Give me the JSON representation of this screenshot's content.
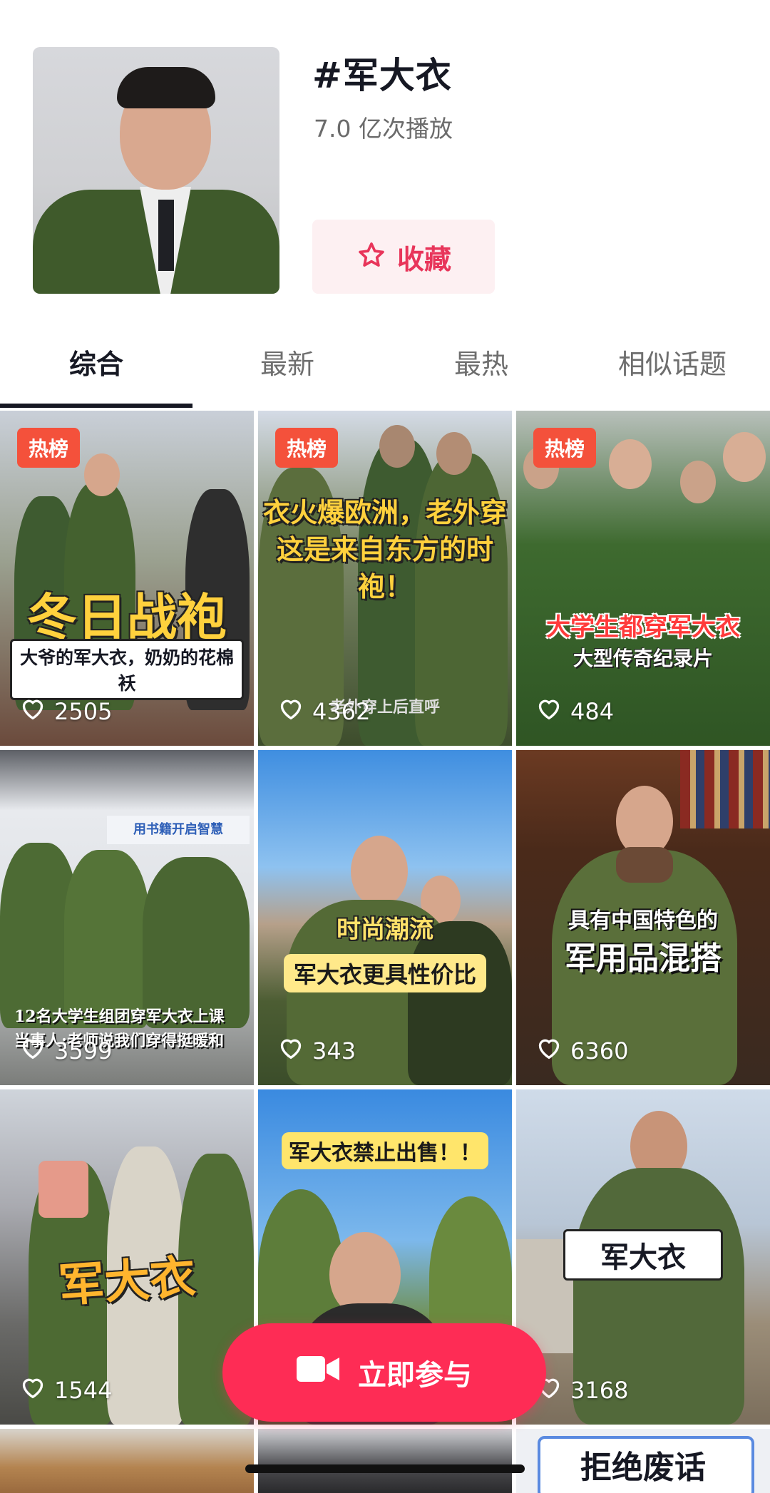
{
  "topic": {
    "title": "#军大衣",
    "play_count": "7.0 亿次播放",
    "favorite_label": "收藏"
  },
  "tabs": [
    "综合",
    "最新",
    "最热",
    "相似话题"
  ],
  "active_tab": 0,
  "colors": {
    "accent": "#fe2c55",
    "badge": "#f4513b",
    "favorite_text": "#e8355a"
  },
  "videos": [
    {
      "badge": "热榜",
      "caption": "冬日战袍",
      "subcaption": "大爷的军大衣，奶奶的花棉袄",
      "likes": "2505"
    },
    {
      "badge": "热榜",
      "caption": "衣火爆欧洲，老外穿",
      "caption2": "这是来自东方的时",
      "caption3": "袍！",
      "subcaption": "老外穿上后直呼",
      "likes": "4362"
    },
    {
      "badge": "热榜",
      "caption": "大学生都穿军大衣",
      "subcaption": "大型传奇纪录片",
      "likes": "484"
    },
    {
      "caption": "12名大学生组团穿军大衣上课",
      "caption2": "当事人:老师说我们穿得挺暖和",
      "banner": "用书籍开启智慧",
      "likes": "3599"
    },
    {
      "caption": "时尚潮流",
      "subcaption": "军大衣更具性价比",
      "likes": "343"
    },
    {
      "caption": "具有中国特色的",
      "caption2": "军用品混搭",
      "likes": "6360"
    },
    {
      "caption": "军大衣",
      "likes": "1544"
    },
    {
      "caption": "军大衣禁止出售！！",
      "likes": ""
    },
    {
      "caption": "军大衣",
      "likes": "3168"
    },
    {
      "caption": "",
      "likes": ""
    },
    {
      "caption": "",
      "likes": ""
    },
    {
      "caption": "拒绝废话",
      "likes": ""
    }
  ],
  "join_button_label": "立即参与"
}
